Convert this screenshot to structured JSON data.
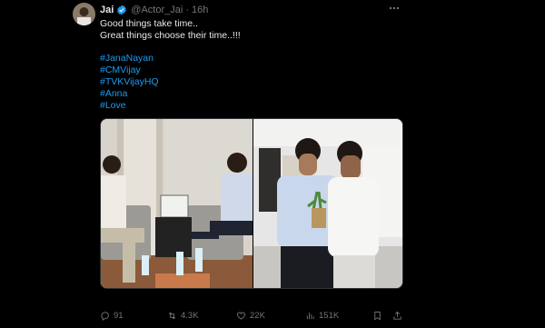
{
  "author": {
    "name": "Jai",
    "handle": "@Actor_Jai",
    "separator": "·",
    "time": "16h"
  },
  "tweet": {
    "lines": [
      "Good things take time..",
      "Great things choose their time..!!!"
    ],
    "hashtags": [
      "#JanaNayan",
      "#CMVijay",
      "#TVKVijayHQ",
      "#Anna",
      "#Love"
    ]
  },
  "actions": {
    "replies": "91",
    "retweets": "4.3K",
    "likes": "22K",
    "views": "151K"
  },
  "colors": {
    "background": "#000000",
    "text": "#e7e9ea",
    "muted": "#71767b",
    "link": "#1d9bf0",
    "verified": "#1d9bf0"
  },
  "icons": [
    "verified-badge-icon",
    "more-icon",
    "reply-icon",
    "retweet-icon",
    "like-icon",
    "views-icon",
    "bookmark-icon",
    "share-icon"
  ]
}
